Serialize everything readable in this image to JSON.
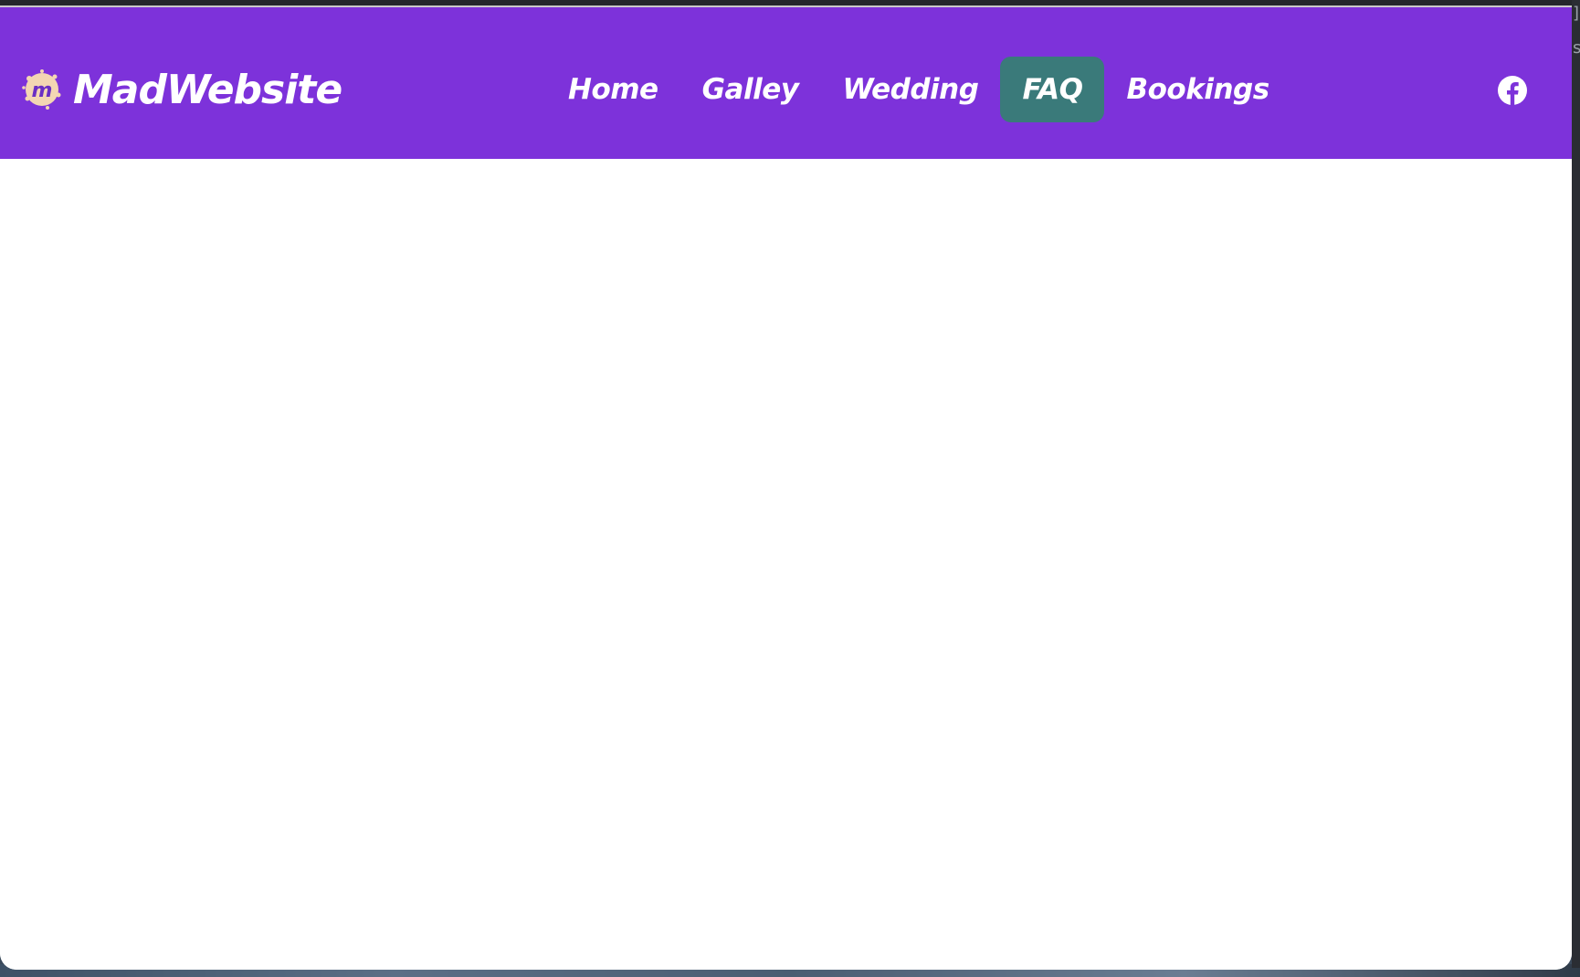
{
  "brand": {
    "name": "MadWebsite",
    "logo_letter": "m",
    "logo_icon": "meetup-splat-logo"
  },
  "nav": {
    "items": [
      {
        "label": "Home",
        "active": false
      },
      {
        "label": "Galley",
        "active": false
      },
      {
        "label": "Wedding",
        "active": false
      },
      {
        "label": "FAQ",
        "active": true
      },
      {
        "label": "Bookings",
        "active": false
      }
    ]
  },
  "social": {
    "icon": "facebook-icon"
  },
  "colors": {
    "navbar_bg": "#7d32da",
    "active_tab_bg": "#3a7a7a",
    "nav_text": "#ffffff",
    "logo_fill": "#f3d6b3",
    "logo_letter": "#6a2fc4"
  }
}
